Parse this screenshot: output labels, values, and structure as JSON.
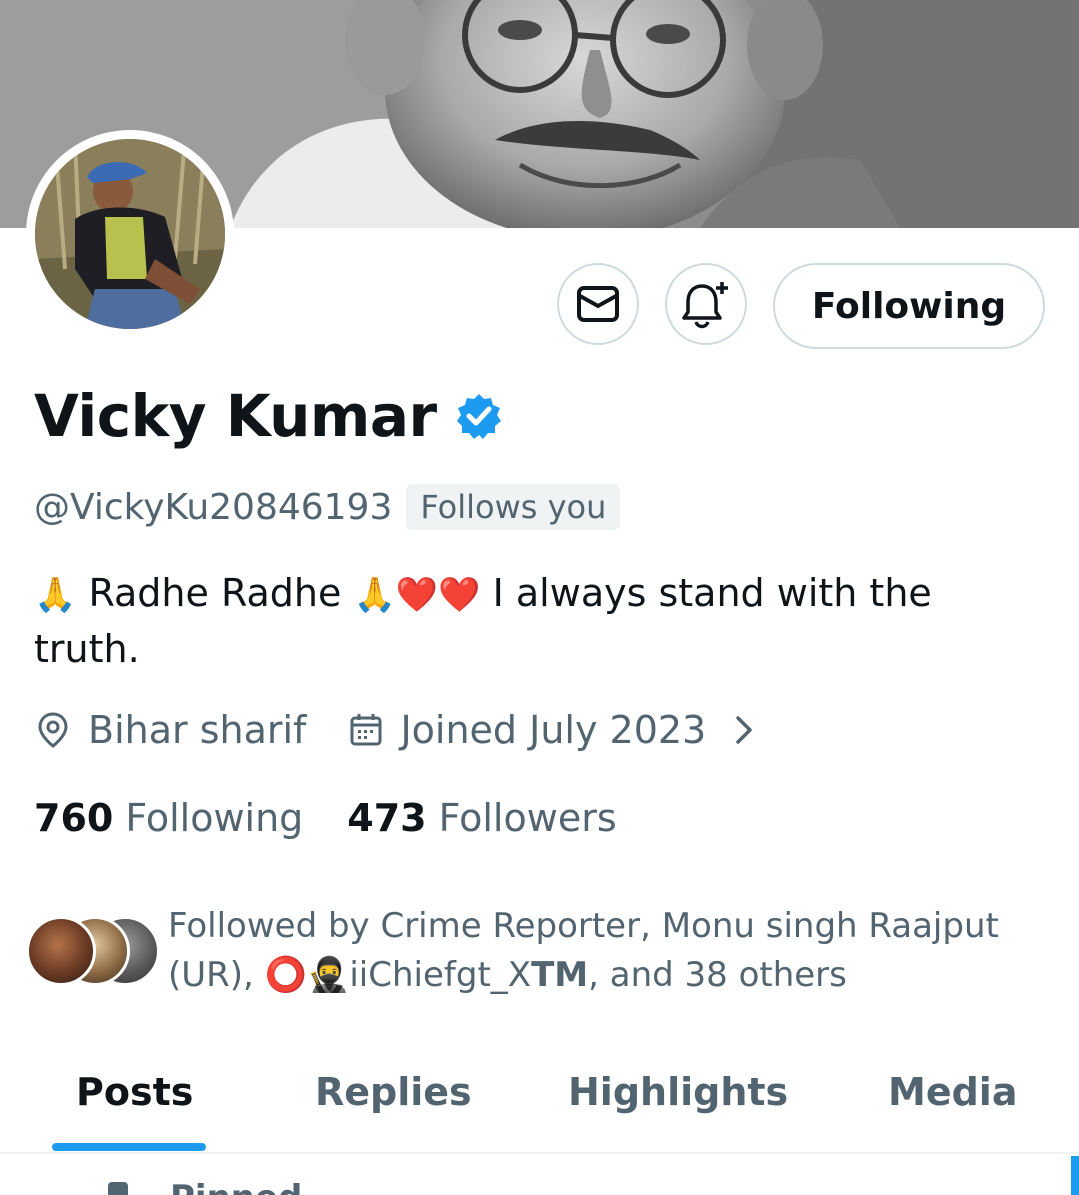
{
  "profile": {
    "display_name": "Vicky Kumar",
    "handle": "@VickyKu20846193",
    "follows_you": "Follows you",
    "bio_part1": "Radhe Radhe",
    "bio_part2": "I always stand with the truth.",
    "bio_emoji_pray": "🙏",
    "bio_emoji_hearts": "❤️❤️",
    "location": "Bihar sharif",
    "joined": "Joined July 2023",
    "following_count": "760",
    "following_label": "Following",
    "followers_count": "473",
    "followers_label": "Followers",
    "verified_color": "#1d9bf0"
  },
  "actions": {
    "message_icon": "envelope-icon",
    "notify_icon": "bell-plus-icon",
    "following_button": "Following"
  },
  "followed_by": {
    "text_part1": "Followed by Crime Reporter, Monu singh Raajput (UR),",
    "emoji_ring": "⭕",
    "emoji_ninja": "🥷",
    "text_part2": "iiChiefgt_X",
    "tm": "TM",
    "text_part3": ", and 38 others"
  },
  "tabs": [
    {
      "label": "Posts",
      "active": true
    },
    {
      "label": "Replies",
      "active": false
    },
    {
      "label": "Highlights",
      "active": false
    },
    {
      "label": "Media",
      "active": false
    }
  ],
  "pinned_label": "Pinned",
  "colors": {
    "accent": "#1d9bf0",
    "text_primary": "#0f1419",
    "text_secondary": "#536471"
  }
}
